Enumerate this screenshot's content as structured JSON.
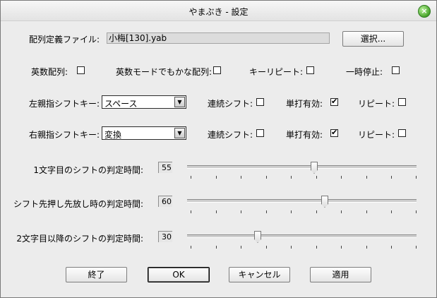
{
  "window": {
    "title": "やまぶき - 設定"
  },
  "file": {
    "label": "配列定義ファイル:",
    "value": "小梅[130].yab",
    "select_button": "選択..."
  },
  "options_row": {
    "eisu_label": "英数配列:",
    "eisu_kana_label": "英数モードでもかな配列:",
    "key_repeat_label": "キーリピート:",
    "pause_label": "一時停止:"
  },
  "left_shift": {
    "label": "左親指シフトキー:",
    "key": "スペース",
    "continuous_label": "連続シフト:",
    "single_label": "単打有効:",
    "single_checked": true,
    "repeat_label": "リピート:"
  },
  "right_shift": {
    "label": "右親指シフトキー:",
    "key": "変換",
    "continuous_label": "連続シフト:",
    "single_label": "単打有効:",
    "single_checked": true,
    "repeat_label": "リピート:"
  },
  "sliders": [
    {
      "label": "1文字目のシフトの判定時間:",
      "value": "55"
    },
    {
      "label": "シフト先押し先放し時の判定時間:",
      "value": "60"
    },
    {
      "label": "2文字目以降のシフトの判定時間:",
      "value": "30"
    }
  ],
  "buttons": {
    "exit": "終了",
    "ok": "OK",
    "cancel": "キャンセル",
    "apply": "適用"
  }
}
